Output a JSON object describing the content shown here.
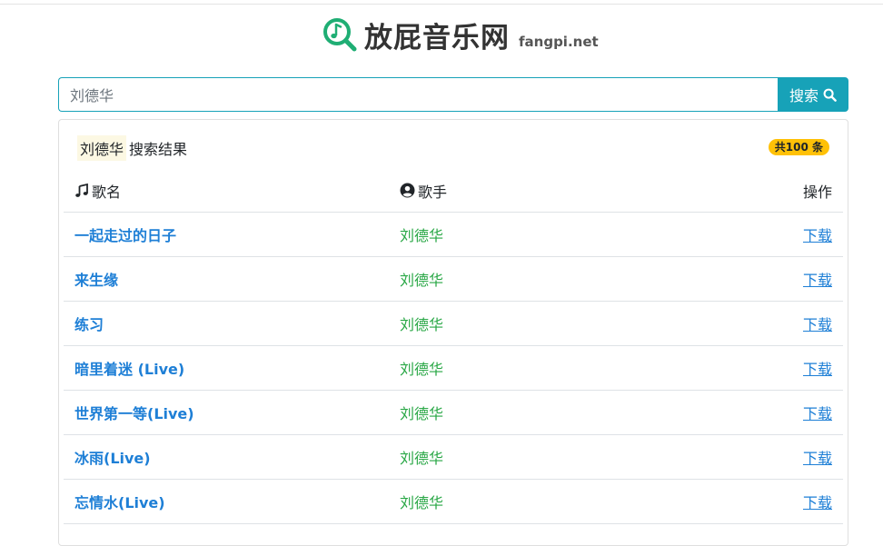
{
  "header": {
    "site_title": "放屁音乐网",
    "site_domain": "fangpi.net",
    "logo_icon": "music-search-icon",
    "accent_color": "#1fae74"
  },
  "search": {
    "value": "刘德华",
    "placeholder": "刘德华",
    "button_label": "搜索",
    "button_color": "#17a2b8"
  },
  "results": {
    "keyword": "刘德华",
    "title_suffix": "搜索结果",
    "count_badge": "共100 条",
    "columns": {
      "song": "歌名",
      "singer": "歌手",
      "action": "操作"
    },
    "rows": [
      {
        "song": "一起走过的日子",
        "singer": "刘德华",
        "action": "下载"
      },
      {
        "song": "来生缘",
        "singer": "刘德华",
        "action": "下载"
      },
      {
        "song": "练习",
        "singer": "刘德华",
        "action": "下载"
      },
      {
        "song": "暗里着迷 (Live)",
        "singer": "刘德华",
        "action": "下载"
      },
      {
        "song": "世界第一等(Live)",
        "singer": "刘德华",
        "action": "下载"
      },
      {
        "song": "冰雨(Live)",
        "singer": "刘德华",
        "action": "下载"
      },
      {
        "song": "忘情水(Live)",
        "singer": "刘德华",
        "action": "下载"
      }
    ]
  }
}
